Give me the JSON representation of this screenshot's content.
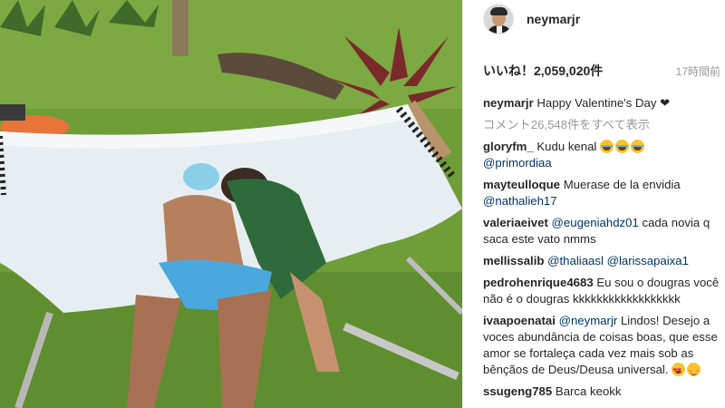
{
  "post": {
    "username": "neymarjr",
    "likes": "いいね！2,059,020件",
    "time": "17時間前"
  },
  "caption": {
    "user": "neymarjr",
    "text": "Happy Valentine's Day ❤"
  },
  "view_all": "コメント26,548件をすべて表示",
  "comments": [
    {
      "user": "gloryfm_",
      "text": "Kudu kenal",
      "emoji": [
        "joy",
        "joy",
        "joy"
      ],
      "mention": "@primordiaa"
    },
    {
      "user": "mayteulloque",
      "text": "Muerase de la envidia",
      "mention": "@nathalieh17"
    },
    {
      "user": "valeriaeivet",
      "mention": "@eugeniahdz01",
      "text": "cada novia q saca este vato nmms"
    },
    {
      "user": "mellissalib",
      "mention": "@thaliaasl",
      "mention2": "@larissapaixa1"
    },
    {
      "user": "pedrohenrique4683",
      "text": "Eu sou o dougras você não é o dougras kkkkkkkkkkkkkkkkkk"
    },
    {
      "user": "ivaapoenatai",
      "mention": "@neymarjr",
      "text": "Lindos! Desejo a voces abundância de coisas boas, que esse amor se fortaleça cada vez mais sob as bênçãos de Deus/Deusa universal.",
      "emoji": [
        "hearteyes",
        "blush"
      ]
    },
    {
      "user": "ssugeng785",
      "text": "Barca keokk"
    }
  ],
  "colors": {
    "link": "#003569",
    "muted": "#999999",
    "text": "#262626"
  }
}
